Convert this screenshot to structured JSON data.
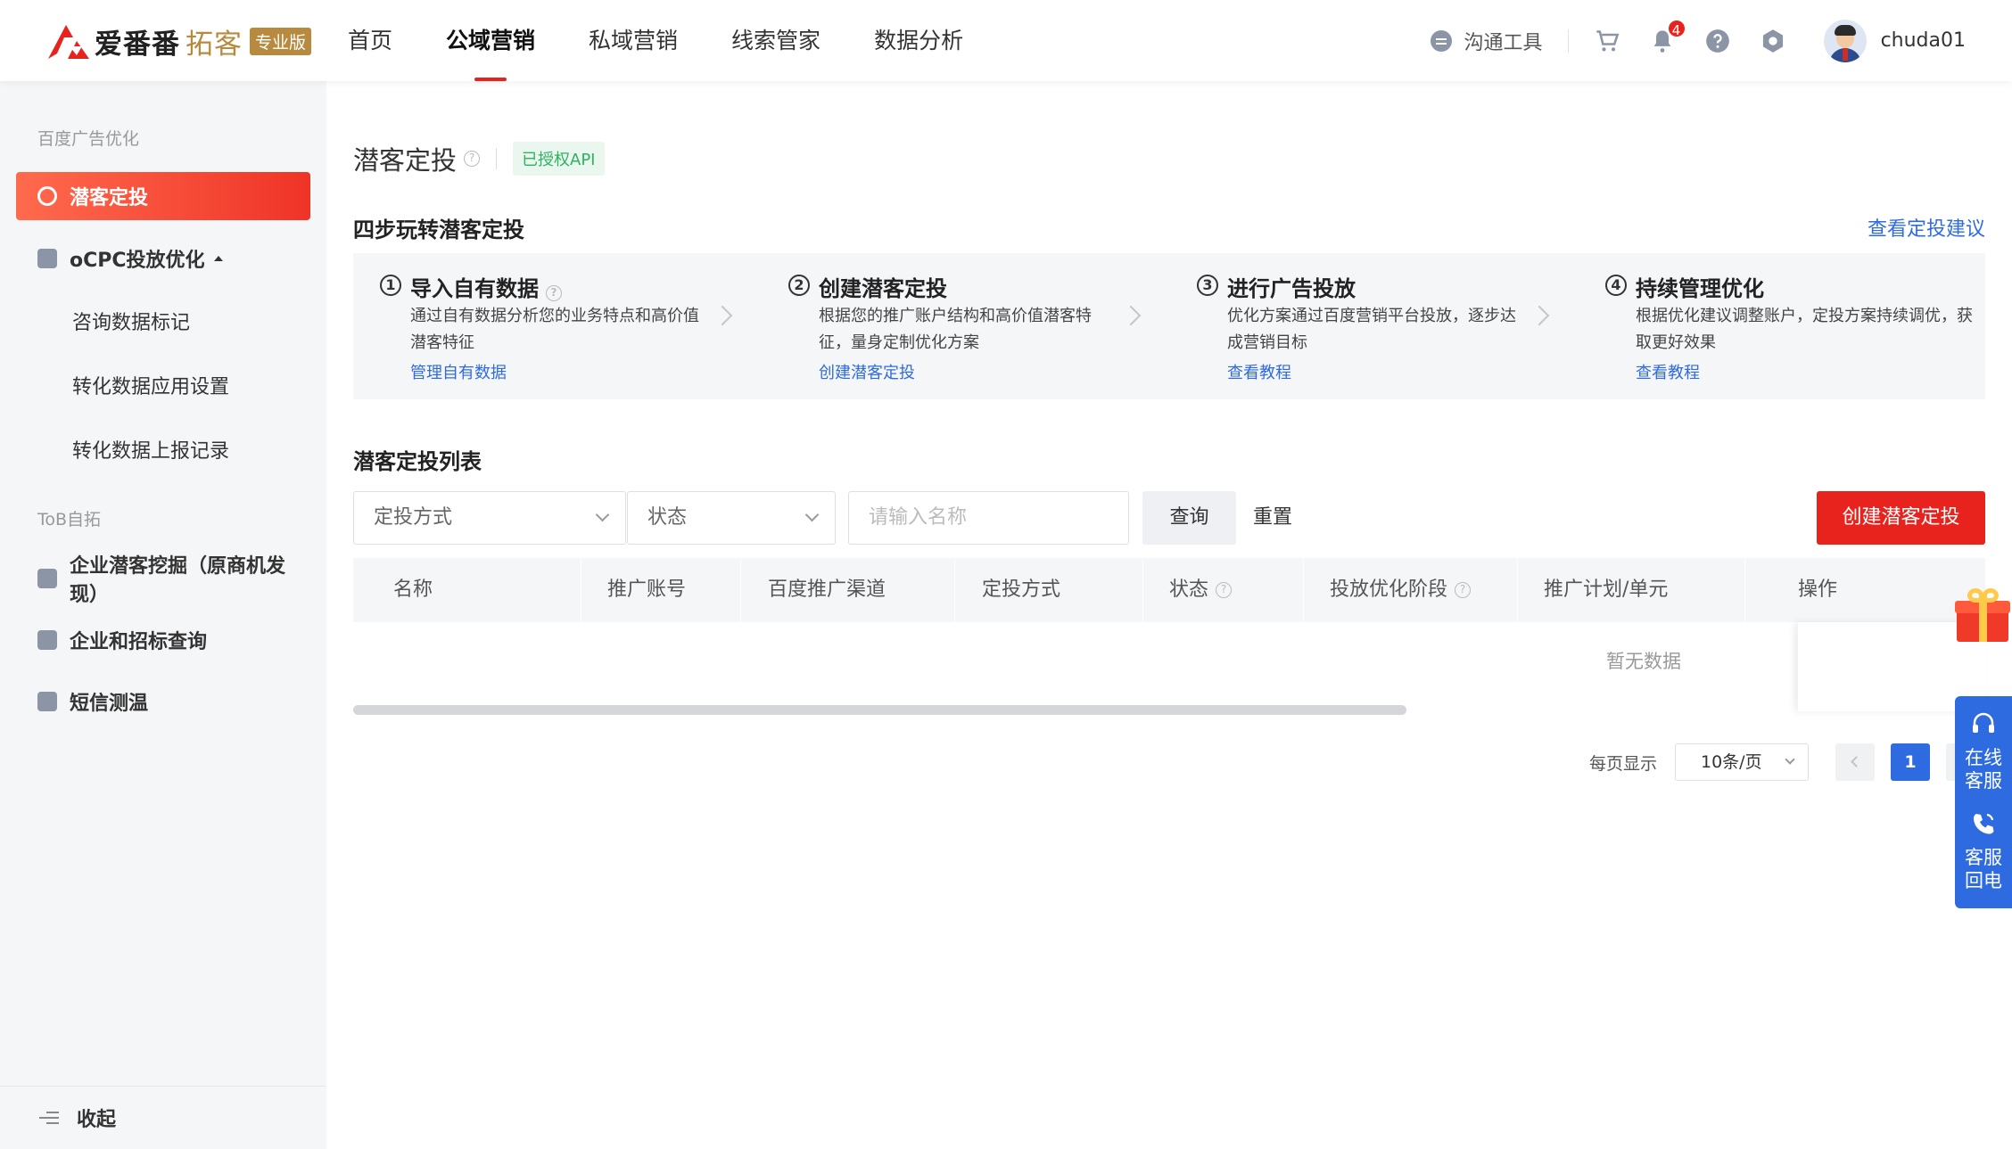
{
  "header": {
    "brand_name": "爱番番",
    "brand_sub": "拓客",
    "brand_badge": "专业版",
    "nav": [
      "首页",
      "公域营销",
      "私域营销",
      "线索管家",
      "数据分析"
    ],
    "nav_active_index": 1,
    "tool_label": "沟通工具",
    "notification_count": "4",
    "username": "chuda01"
  },
  "sidebar": {
    "group1": "百度广告优化",
    "item_active": "潜客定投",
    "item_ocpc": "oCPC投放优化",
    "sub_items": [
      "咨询数据标记",
      "转化数据应用设置",
      "转化数据上报记录"
    ],
    "group2": "ToB自拓",
    "item_mining": "企业潜客挖掘（原商机发现）",
    "item_bidding": "企业和招标查询",
    "item_sms": "短信测温",
    "collapse": "收起"
  },
  "main": {
    "title": "潜客定投",
    "api_tag": "已授权API",
    "steps_title": "四步玩转潜客定投",
    "advice_link": "查看定投建议",
    "steps": [
      {
        "num": "1",
        "title": "导入自有数据",
        "desc": "通过自有数据分析您的业务特点和高价值潜客特征",
        "link": "管理自有数据"
      },
      {
        "num": "2",
        "title": "创建潜客定投",
        "desc": "根据您的推广账户结构和高价值潜客特征，量身定制优化方案",
        "link": "创建潜客定投"
      },
      {
        "num": "3",
        "title": "进行广告投放",
        "desc": "优化方案通过百度营销平台投放，逐步达成营销目标",
        "link": "查看教程"
      },
      {
        "num": "4",
        "title": "持续管理优化",
        "desc": "根据优化建议调整账户，定投方案持续调优，获取更好效果",
        "link": "查看教程"
      }
    ],
    "list_title": "潜客定投列表",
    "filters": {
      "mode_placeholder": "定投方式",
      "status_placeholder": "状态",
      "name_placeholder": "请输入名称",
      "query": "查询",
      "reset": "重置",
      "create": "创建潜客定投"
    },
    "table": {
      "columns": [
        "名称",
        "推广账号",
        "百度推广渠道",
        "定投方式",
        "状态",
        "投放优化阶段",
        "推广计划/单元",
        "操作"
      ],
      "empty": "暂无数据"
    },
    "pagination": {
      "per_page_label": "每页显示",
      "page_size": "10条/页",
      "current_page": "1"
    }
  },
  "float": {
    "online_service": "在线客服",
    "callback": "客服回电"
  },
  "colors": {
    "brand_red": "#e8231d",
    "link_blue": "#2f6be0",
    "api_green": "#2fb161"
  }
}
